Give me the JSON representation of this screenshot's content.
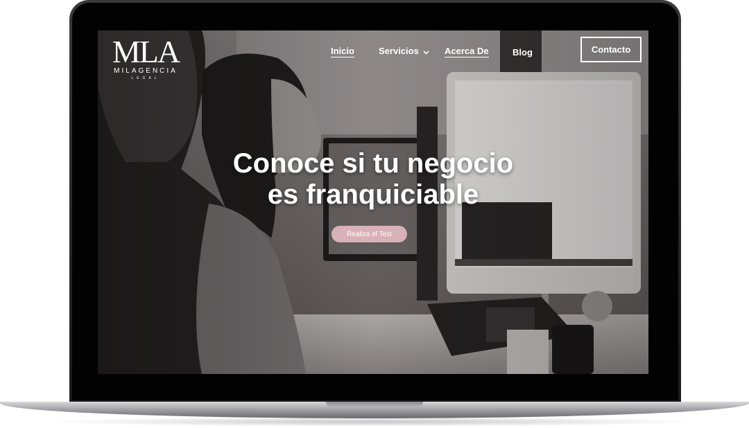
{
  "brand": {
    "mark": "MLA",
    "name": "MILAGENCIA",
    "sub": "LEGAL"
  },
  "nav": {
    "items": [
      {
        "label": "Inicio",
        "underlined": true
      },
      {
        "label": "Servicios",
        "has_dropdown": true
      },
      {
        "label": "Acerca De",
        "underlined": true
      },
      {
        "label": "Blog"
      }
    ],
    "contact_label": "Contacto"
  },
  "hero": {
    "title_line1": "Conoce si tu negocio",
    "title_line2": "es franquiciable",
    "cta_label": "Realiza el Test",
    "cta_color": "#d9b1b8"
  },
  "icons": {
    "servicios_dropdown": "chevron-down-icon"
  }
}
